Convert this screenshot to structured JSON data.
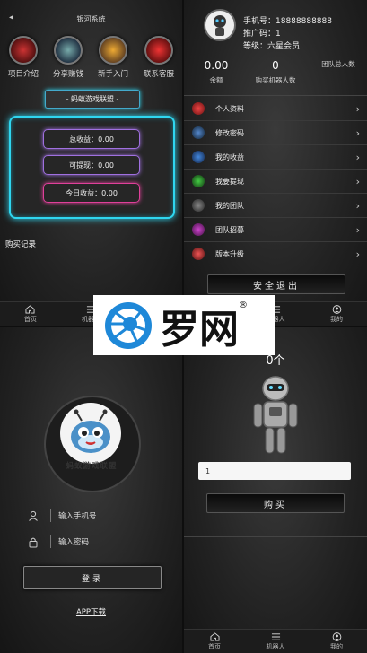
{
  "colors": {
    "neon_cyan": "#2fd6f0",
    "neon_pink": "#e0409a",
    "neon_violet": "#a070e0",
    "brand_blue": "#1e88d8"
  },
  "top_left": {
    "back_icon": "◂",
    "title": "银河系统",
    "features": [
      {
        "label": "项目介绍",
        "icon": "intro-icon"
      },
      {
        "label": "分享赚钱",
        "icon": "share-icon"
      },
      {
        "label": "新手入门",
        "icon": "guide-icon"
      },
      {
        "label": "联系客服",
        "icon": "service-icon"
      }
    ],
    "banner": "- 蚂蚁游戏联盟 -",
    "stats": [
      {
        "label": "总收益：0.00"
      },
      {
        "label": "可提现：0.00"
      },
      {
        "label": "今日收益：0.00"
      }
    ],
    "records_title": "购买记录",
    "nav": [
      {
        "label": "首页"
      },
      {
        "label": "机器人"
      }
    ]
  },
  "top_right": {
    "profile": {
      "phone": "手机号：18888888888",
      "promo_code": "推广码：1",
      "level": "等级：六星会员"
    },
    "summary": [
      {
        "value": "0.00",
        "label": "余额"
      },
      {
        "value": "0",
        "label": "购买机器人数"
      },
      {
        "value": "",
        "label": "团队总人数"
      }
    ],
    "menu": [
      {
        "label": "个人资料",
        "icon": "profile-icon"
      },
      {
        "label": "修改密码",
        "icon": "password-icon"
      },
      {
        "label": "我的收益",
        "icon": "earnings-icon"
      },
      {
        "label": "我要提现",
        "icon": "withdraw-icon"
      },
      {
        "label": "我的团队",
        "icon": "team-icon"
      },
      {
        "label": "团队招募",
        "icon": "recruit-icon"
      },
      {
        "label": "版本升级",
        "icon": "upgrade-icon"
      }
    ],
    "logout": "安全退出",
    "nav": [
      {
        "label": "机器人"
      },
      {
        "label": "我的"
      }
    ]
  },
  "watermark": {
    "text": "罗网",
    "registered": "®"
  },
  "bottom_left": {
    "logo_text": "蚂蚁游戏联盟",
    "phone_placeholder": "输入手机号",
    "password_placeholder": "输入密码",
    "login": "登录",
    "app_download": "APP下载"
  },
  "bottom_right": {
    "count": "0个",
    "quantity_value": "1",
    "buy": "购买",
    "nav": [
      {
        "label": "首页"
      },
      {
        "label": "机器人"
      },
      {
        "label": "我的"
      }
    ]
  }
}
